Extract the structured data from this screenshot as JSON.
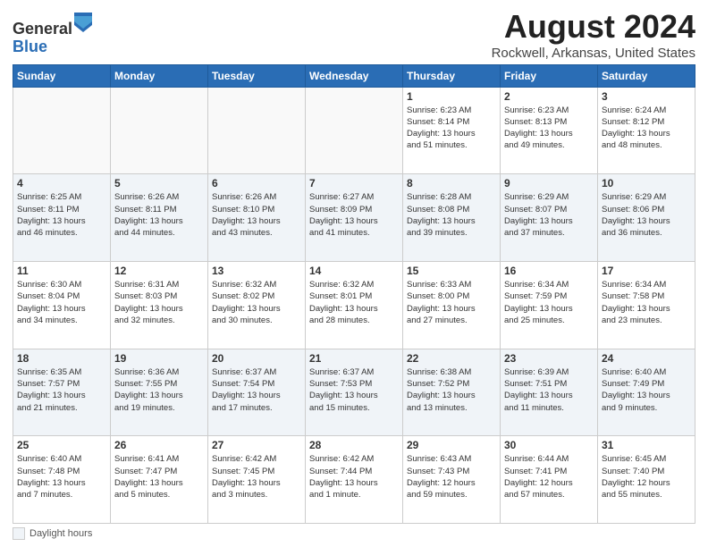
{
  "header": {
    "logo_general": "General",
    "logo_blue": "Blue",
    "main_title": "August 2024",
    "subtitle": "Rockwell, Arkansas, United States"
  },
  "days_of_week": [
    "Sunday",
    "Monday",
    "Tuesday",
    "Wednesday",
    "Thursday",
    "Friday",
    "Saturday"
  ],
  "footer": {
    "legend_label": "Daylight hours"
  },
  "weeks": [
    {
      "alt": false,
      "days": [
        {
          "num": "",
          "info": ""
        },
        {
          "num": "",
          "info": ""
        },
        {
          "num": "",
          "info": ""
        },
        {
          "num": "",
          "info": ""
        },
        {
          "num": "1",
          "info": "Sunrise: 6:23 AM\nSunset: 8:14 PM\nDaylight: 13 hours\nand 51 minutes."
        },
        {
          "num": "2",
          "info": "Sunrise: 6:23 AM\nSunset: 8:13 PM\nDaylight: 13 hours\nand 49 minutes."
        },
        {
          "num": "3",
          "info": "Sunrise: 6:24 AM\nSunset: 8:12 PM\nDaylight: 13 hours\nand 48 minutes."
        }
      ]
    },
    {
      "alt": true,
      "days": [
        {
          "num": "4",
          "info": "Sunrise: 6:25 AM\nSunset: 8:11 PM\nDaylight: 13 hours\nand 46 minutes."
        },
        {
          "num": "5",
          "info": "Sunrise: 6:26 AM\nSunset: 8:11 PM\nDaylight: 13 hours\nand 44 minutes."
        },
        {
          "num": "6",
          "info": "Sunrise: 6:26 AM\nSunset: 8:10 PM\nDaylight: 13 hours\nand 43 minutes."
        },
        {
          "num": "7",
          "info": "Sunrise: 6:27 AM\nSunset: 8:09 PM\nDaylight: 13 hours\nand 41 minutes."
        },
        {
          "num": "8",
          "info": "Sunrise: 6:28 AM\nSunset: 8:08 PM\nDaylight: 13 hours\nand 39 minutes."
        },
        {
          "num": "9",
          "info": "Sunrise: 6:29 AM\nSunset: 8:07 PM\nDaylight: 13 hours\nand 37 minutes."
        },
        {
          "num": "10",
          "info": "Sunrise: 6:29 AM\nSunset: 8:06 PM\nDaylight: 13 hours\nand 36 minutes."
        }
      ]
    },
    {
      "alt": false,
      "days": [
        {
          "num": "11",
          "info": "Sunrise: 6:30 AM\nSunset: 8:04 PM\nDaylight: 13 hours\nand 34 minutes."
        },
        {
          "num": "12",
          "info": "Sunrise: 6:31 AM\nSunset: 8:03 PM\nDaylight: 13 hours\nand 32 minutes."
        },
        {
          "num": "13",
          "info": "Sunrise: 6:32 AM\nSunset: 8:02 PM\nDaylight: 13 hours\nand 30 minutes."
        },
        {
          "num": "14",
          "info": "Sunrise: 6:32 AM\nSunset: 8:01 PM\nDaylight: 13 hours\nand 28 minutes."
        },
        {
          "num": "15",
          "info": "Sunrise: 6:33 AM\nSunset: 8:00 PM\nDaylight: 13 hours\nand 27 minutes."
        },
        {
          "num": "16",
          "info": "Sunrise: 6:34 AM\nSunset: 7:59 PM\nDaylight: 13 hours\nand 25 minutes."
        },
        {
          "num": "17",
          "info": "Sunrise: 6:34 AM\nSunset: 7:58 PM\nDaylight: 13 hours\nand 23 minutes."
        }
      ]
    },
    {
      "alt": true,
      "days": [
        {
          "num": "18",
          "info": "Sunrise: 6:35 AM\nSunset: 7:57 PM\nDaylight: 13 hours\nand 21 minutes."
        },
        {
          "num": "19",
          "info": "Sunrise: 6:36 AM\nSunset: 7:55 PM\nDaylight: 13 hours\nand 19 minutes."
        },
        {
          "num": "20",
          "info": "Sunrise: 6:37 AM\nSunset: 7:54 PM\nDaylight: 13 hours\nand 17 minutes."
        },
        {
          "num": "21",
          "info": "Sunrise: 6:37 AM\nSunset: 7:53 PM\nDaylight: 13 hours\nand 15 minutes."
        },
        {
          "num": "22",
          "info": "Sunrise: 6:38 AM\nSunset: 7:52 PM\nDaylight: 13 hours\nand 13 minutes."
        },
        {
          "num": "23",
          "info": "Sunrise: 6:39 AM\nSunset: 7:51 PM\nDaylight: 13 hours\nand 11 minutes."
        },
        {
          "num": "24",
          "info": "Sunrise: 6:40 AM\nSunset: 7:49 PM\nDaylight: 13 hours\nand 9 minutes."
        }
      ]
    },
    {
      "alt": false,
      "days": [
        {
          "num": "25",
          "info": "Sunrise: 6:40 AM\nSunset: 7:48 PM\nDaylight: 13 hours\nand 7 minutes."
        },
        {
          "num": "26",
          "info": "Sunrise: 6:41 AM\nSunset: 7:47 PM\nDaylight: 13 hours\nand 5 minutes."
        },
        {
          "num": "27",
          "info": "Sunrise: 6:42 AM\nSunset: 7:45 PM\nDaylight: 13 hours\nand 3 minutes."
        },
        {
          "num": "28",
          "info": "Sunrise: 6:42 AM\nSunset: 7:44 PM\nDaylight: 13 hours\nand 1 minute."
        },
        {
          "num": "29",
          "info": "Sunrise: 6:43 AM\nSunset: 7:43 PM\nDaylight: 12 hours\nand 59 minutes."
        },
        {
          "num": "30",
          "info": "Sunrise: 6:44 AM\nSunset: 7:41 PM\nDaylight: 12 hours\nand 57 minutes."
        },
        {
          "num": "31",
          "info": "Sunrise: 6:45 AM\nSunset: 7:40 PM\nDaylight: 12 hours\nand 55 minutes."
        }
      ]
    }
  ]
}
